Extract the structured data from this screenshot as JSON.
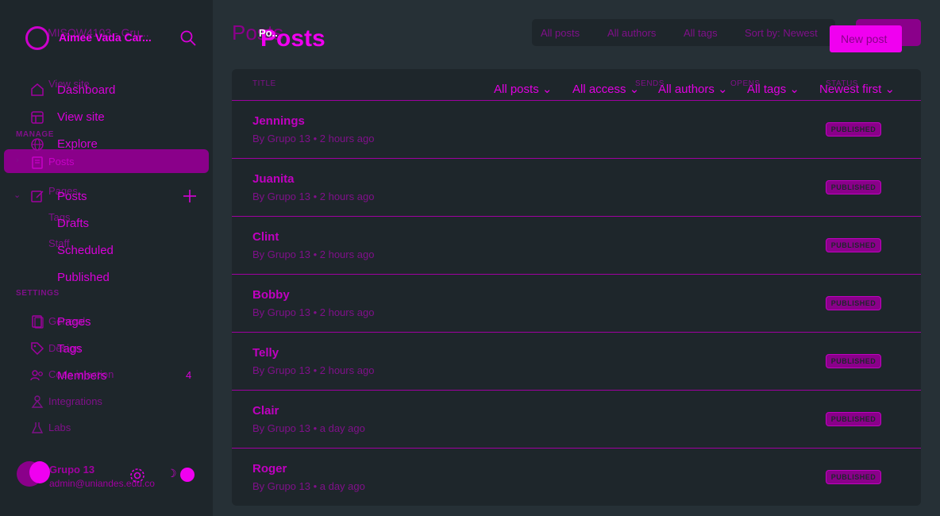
{
  "sidebar": {
    "ghost_site_title": "MISOW4103 - Gru...",
    "site_title": "Aimee Vada Car...",
    "ghost_view_site": "View site",
    "section_manage": "MANAGE",
    "ghost_posts": "Posts",
    "ghost_pages": "Pages",
    "ghost_tags": "Tags",
    "ghost_staff": "Staff",
    "section_settings": "SETTINGS",
    "ghost_general": "General",
    "ghost_design": "Design",
    "ghost_code_injection": "Code injection",
    "ghost_integrations": "Integrations",
    "ghost_labs": "Labs",
    "nav": [
      {
        "label": "Dashboard",
        "icon": "home-icon"
      },
      {
        "label": "View site",
        "icon": "layout-icon"
      },
      {
        "label": "Explore",
        "icon": "globe-icon"
      },
      {
        "label": "Posts",
        "icon": "edit-icon"
      },
      {
        "label": "Drafts"
      },
      {
        "label": "Scheduled"
      },
      {
        "label": "Published"
      },
      {
        "label": "Pages",
        "icon": "page-icon"
      },
      {
        "label": "Tags",
        "icon": "tag-icon"
      },
      {
        "label": "Members",
        "icon": "members-icon",
        "badge": "4"
      }
    ],
    "user_name": "Grupo 13",
    "user_email": "admin@uniandes.edu.co"
  },
  "header": {
    "ghost_title": "Posts",
    "title": "Posts",
    "title_overlay": "Po..",
    "filters": [
      "All posts",
      "All authors",
      "All tags",
      "Sort by: Newest"
    ],
    "ghost_new_post": "New po",
    "new_post": "New post"
  },
  "table": {
    "columns": [
      "TITLE",
      "SENDS",
      "OPENS",
      "STATUS"
    ],
    "filters": [
      "All posts",
      "All access",
      "All authors",
      "All tags",
      "Newest first"
    ],
    "rows": [
      {
        "title": "Jennings",
        "meta": "By Grupo 13 • 2 hours ago",
        "status": "PUBLISHED"
      },
      {
        "title": "Juanita",
        "meta": "By Grupo 13 • 2 hours ago",
        "status": "PUBLISHED"
      },
      {
        "title": "Clint",
        "meta": "By Grupo 13 • 2 hours ago",
        "status": "PUBLISHED"
      },
      {
        "title": "Bobby",
        "meta": "By Grupo 13 • 2 hours ago",
        "status": "PUBLISHED"
      },
      {
        "title": "Telly",
        "meta": "By Grupo 13 • 2 hours ago",
        "status": "PUBLISHED"
      },
      {
        "title": "Clair",
        "meta": "By Grupo 13 • a day ago",
        "status": "PUBLISHED"
      },
      {
        "title": "Roger",
        "meta": "By Grupo 13 • a day ago",
        "status": "PUBLISHED"
      }
    ]
  },
  "colors": {
    "accent": "#f000f0",
    "muted": "#80108a",
    "highlight": "#8a008a",
    "background": "#263036",
    "sidebar": "#1e262b"
  }
}
